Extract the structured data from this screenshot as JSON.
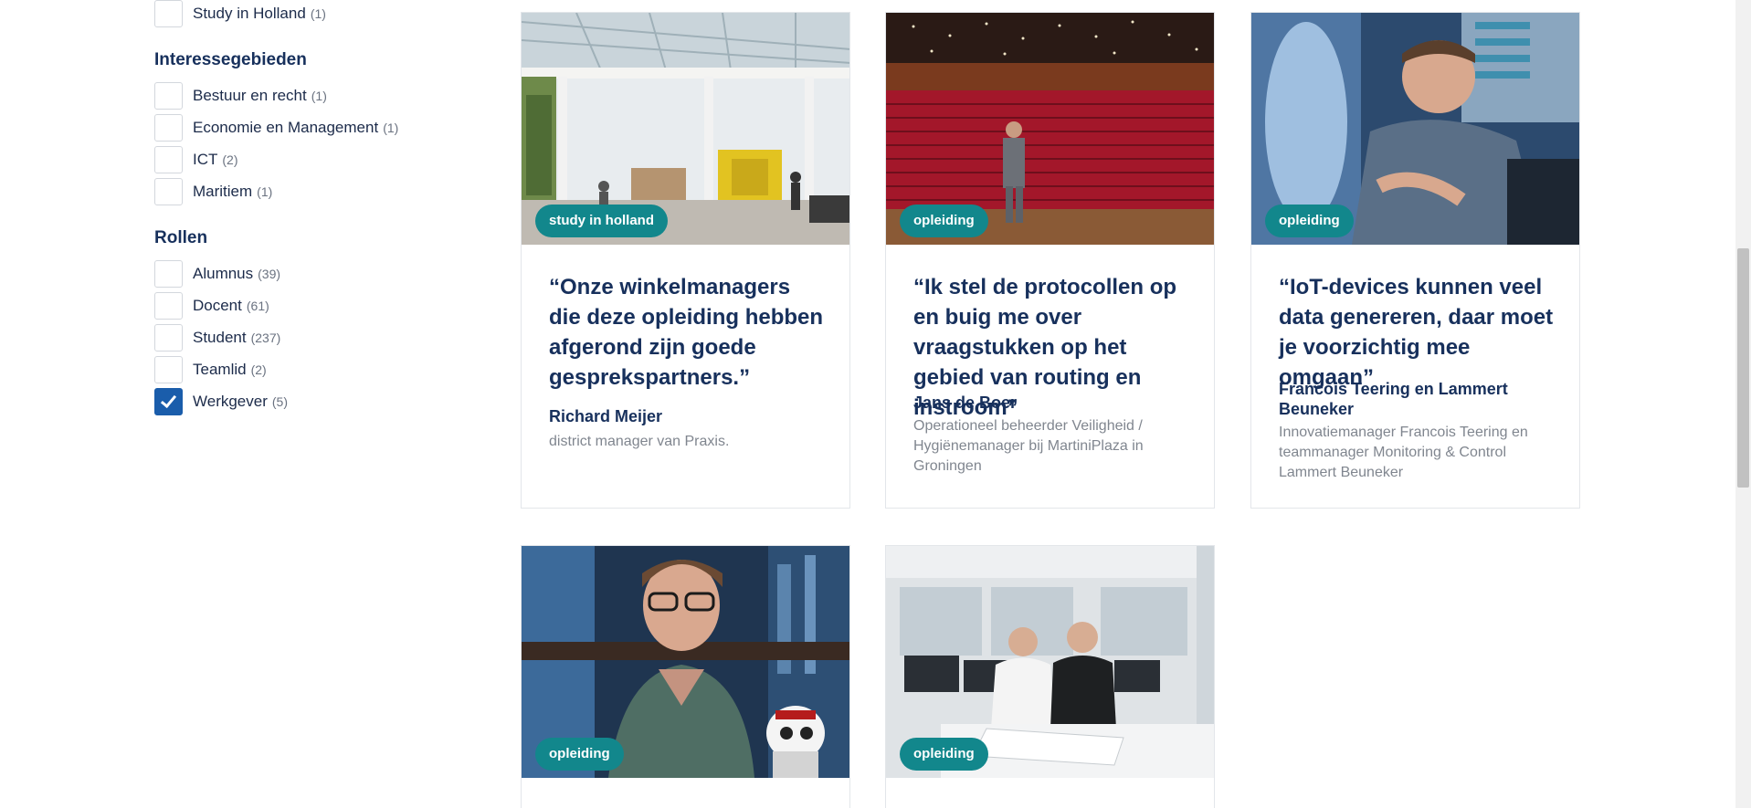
{
  "filters": {
    "top_item": {
      "label": "Study in Holland",
      "count": "(1)",
      "checked": false
    },
    "interest": {
      "heading": "Interessegebieden",
      "items": [
        {
          "label": "Bestuur en recht",
          "count": "(1)",
          "checked": false
        },
        {
          "label": "Economie en Management",
          "count": "(1)",
          "checked": false
        },
        {
          "label": "ICT",
          "count": "(2)",
          "checked": false
        },
        {
          "label": "Maritiem",
          "count": "(1)",
          "checked": false
        }
      ]
    },
    "roles": {
      "heading": "Rollen",
      "items": [
        {
          "label": "Alumnus",
          "count": "(39)",
          "checked": false
        },
        {
          "label": "Docent",
          "count": "(61)",
          "checked": false
        },
        {
          "label": "Student",
          "count": "(237)",
          "checked": false
        },
        {
          "label": "Teamlid",
          "count": "(2)",
          "checked": false
        },
        {
          "label": "Werkgever",
          "count": "(5)",
          "checked": true
        }
      ]
    }
  },
  "cards": [
    {
      "tag": "study in holland",
      "quote": "“Onze winkelmanagers die deze opleiding hebben afgerond zijn goede gesprekspartners.”",
      "name": "Richard Meijer",
      "role": "district manager van Praxis."
    },
    {
      "tag": "opleiding",
      "quote": "“Ik stel de protocollen op en buig me over vraagstukken op het gebied van routing en instroom”",
      "name": "Jans de Boer",
      "role": "Operationeel beheerder Veiligheid / Hygiënemanager bij MartiniPlaza in Groningen"
    },
    {
      "tag": "opleiding",
      "quote": "“IoT-devices kunnen veel data genereren, daar moet je voorzichtig mee omgaan”",
      "name": "Francois Teering en Lammert Beuneker",
      "role": "Innovatiemanager Francois Teering en teammanager Monitoring & Control Lammert Beuneker"
    },
    {
      "tag": "opleiding"
    },
    {
      "tag": "opleiding"
    }
  ],
  "colors": {
    "accent_teal": "#12878c",
    "checkbox_checked": "#1a5dab",
    "heading_navy": "#17305c"
  }
}
